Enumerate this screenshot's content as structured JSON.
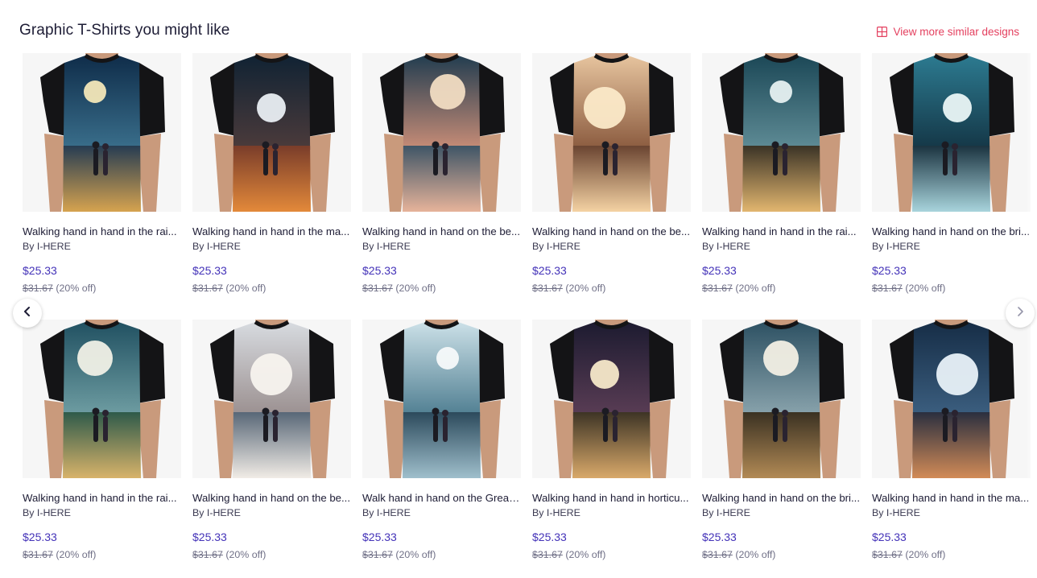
{
  "section": {
    "title": "Graphic T-Shirts you might like",
    "view_more_label": "View more similar designs",
    "view_more_icon": "grid-icon",
    "accent_color": "#e4405f",
    "price_color": "#4332b8"
  },
  "navigation": {
    "prev_icon": "chevron-left-icon",
    "next_icon": "chevron-right-icon"
  },
  "products": [
    {
      "title": "Walking hand in hand in the rai...",
      "artist": "By I-HERE",
      "price": "$25.33",
      "original_price": "$31.67",
      "discount": "(20% off)",
      "scene": {
        "sky": [
          "#0e2b48",
          "#3a6f8c"
        ],
        "moon": "#f3e7b8",
        "ground": [
          "#263c52",
          "#d6a34f"
        ]
      }
    },
    {
      "title": "Walking hand in hand in the ma...",
      "artist": "By I-HERE",
      "price": "$25.33",
      "original_price": "$31.67",
      "discount": "(20% off)",
      "scene": {
        "sky": [
          "#0f2233",
          "#4c3b3b"
        ],
        "moon": "#e9eef2",
        "ground": [
          "#7a3d2a",
          "#e3893a"
        ]
      }
    },
    {
      "title": "Walking hand in hand on the be...",
      "artist": "By I-HERE",
      "price": "$25.33",
      "original_price": "$31.67",
      "discount": "(20% off)",
      "scene": {
        "sky": [
          "#1e3b4f",
          "#c98d77"
        ],
        "moon": "#f1dcc2",
        "ground": [
          "#3f5566",
          "#e6b39a"
        ]
      }
    },
    {
      "title": "Walking hand in hand on the be...",
      "artist": "By I-HERE",
      "price": "$25.33",
      "original_price": "$31.67",
      "discount": "(20% off)",
      "scene": {
        "sky": [
          "#e9c7a1",
          "#8a5a3e"
        ],
        "moon": "#fbe9c8",
        "ground": [
          "#6a4431",
          "#f4d2a3"
        ]
      }
    },
    {
      "title": "Walking hand in hand in the rai...",
      "artist": "By I-HERE",
      "price": "$25.33",
      "original_price": "$31.67",
      "discount": "(20% off)",
      "scene": {
        "sky": [
          "#1a4655",
          "#5f8c96"
        ],
        "moon": "#e6f0f0",
        "ground": [
          "#3b3326",
          "#e2b66f"
        ]
      }
    },
    {
      "title": "Walking hand in hand on the bri...",
      "artist": "By I-HERE",
      "price": "$25.33",
      "original_price": "$31.67",
      "discount": "(20% off)",
      "scene": {
        "sky": [
          "#2d7c92",
          "#143646"
        ],
        "moon": "#eaf6f6",
        "ground": [
          "#1b3340",
          "#a8d4dc"
        ]
      }
    },
    {
      "title": "Walking hand in hand in the rai...",
      "artist": "By I-HERE",
      "price": "$25.33",
      "original_price": "$31.67",
      "discount": "(20% off)",
      "scene": {
        "sky": [
          "#1f4f60",
          "#6f9ea3"
        ],
        "moon": "#f0f0e6",
        "ground": [
          "#2e5a4a",
          "#d8b36a"
        ]
      }
    },
    {
      "title": "Walking hand in hand on the be...",
      "artist": "By I-HERE",
      "price": "$25.33",
      "original_price": "$31.67",
      "discount": "(20% off)",
      "scene": {
        "sky": [
          "#d9dde2",
          "#9a8f8f"
        ],
        "moon": "#f7f3ee",
        "ground": [
          "#586777",
          "#f1ece6"
        ]
      }
    },
    {
      "title": "Walk hand in hand on the Great ...",
      "artist": "By I-HERE",
      "price": "$25.33",
      "original_price": "$31.67",
      "discount": "(20% off)",
      "scene": {
        "sky": [
          "#cfe3ea",
          "#4f7e91"
        ],
        "moon": "#f6f9fa",
        "ground": [
          "#2c4a5c",
          "#9fbfcc"
        ]
      }
    },
    {
      "title": "Walking hand in hand in horticu...",
      "artist": "By I-HERE",
      "price": "$25.33",
      "original_price": "$31.67",
      "discount": "(20% off)",
      "scene": {
        "sky": [
          "#1b1a2f",
          "#5a3d55"
        ],
        "moon": "#f5e8c9",
        "ground": [
          "#3d3425",
          "#d9a96a"
        ]
      }
    },
    {
      "title": "Walking hand in hand on the bri...",
      "artist": "By I-HERE",
      "price": "$25.33",
      "original_price": "$31.67",
      "discount": "(20% off)",
      "scene": {
        "sky": [
          "#2b4f61",
          "#8aa4ad"
        ],
        "moon": "#f2efe4",
        "ground": [
          "#3a3122",
          "#b28a55"
        ]
      }
    },
    {
      "title": "Walking hand in hand in the ma...",
      "artist": "By I-HERE",
      "price": "$25.33",
      "original_price": "$31.67",
      "discount": "(20% off)",
      "scene": {
        "sky": [
          "#152c45",
          "#3c5f80"
        ],
        "moon": "#e8f1f8",
        "ground": [
          "#2a2f3f",
          "#d28b57"
        ]
      }
    }
  ]
}
